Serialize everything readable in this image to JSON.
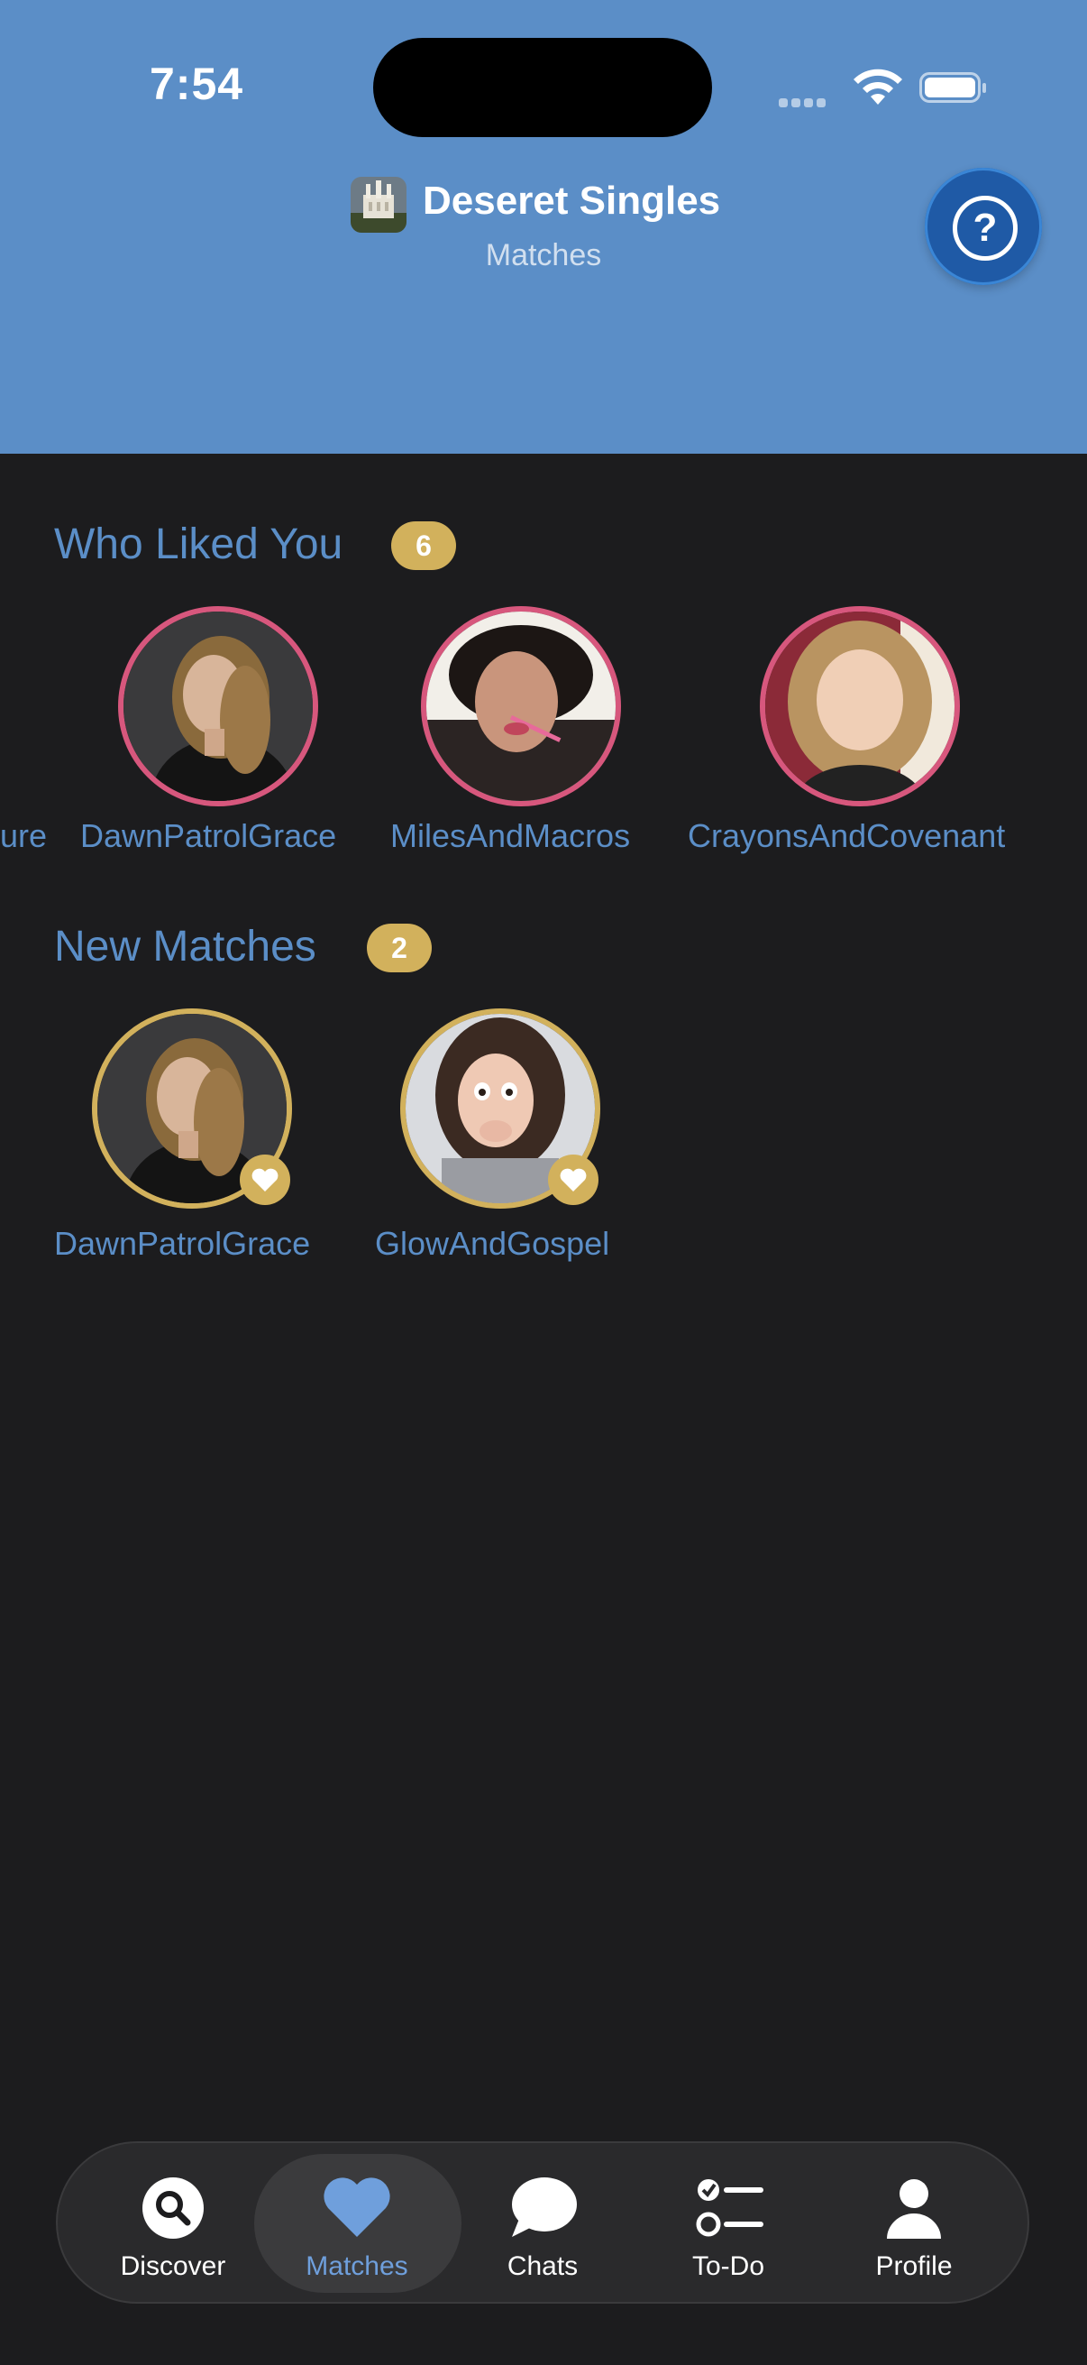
{
  "status_bar": {
    "time": "7:54"
  },
  "header": {
    "app_title": "Deseret Singles",
    "subtitle": "Matches",
    "help_glyph": "?"
  },
  "who_liked_you": {
    "title": "Who Liked You",
    "count": "6",
    "items": [
      {
        "name": "ure"
      },
      {
        "name": "DawnPatrolGrace"
      },
      {
        "name": "MilesAndMacros"
      },
      {
        "name": "CrayonsAndCovenant"
      }
    ]
  },
  "new_matches": {
    "title": "New Matches",
    "count": "2",
    "items": [
      {
        "name": "DawnPatrolGrace"
      },
      {
        "name": "GlowAndGospel"
      }
    ]
  },
  "tabs": [
    {
      "label": "Discover",
      "icon": "search-icon"
    },
    {
      "label": "Matches",
      "icon": "heart-icon",
      "active": true
    },
    {
      "label": "Chats",
      "icon": "chat-bubble-icon"
    },
    {
      "label": "To-Do",
      "icon": "checklist-icon"
    },
    {
      "label": "Profile",
      "icon": "person-icon"
    }
  ],
  "colors": {
    "header_bg": "#5b8ec7",
    "page_bg": "#1c1c1e",
    "accent_blue": "#5b8ec7",
    "gold": "#d2b15c",
    "pink_ring": "#d7577d",
    "help_button": "#1f5aa6"
  }
}
